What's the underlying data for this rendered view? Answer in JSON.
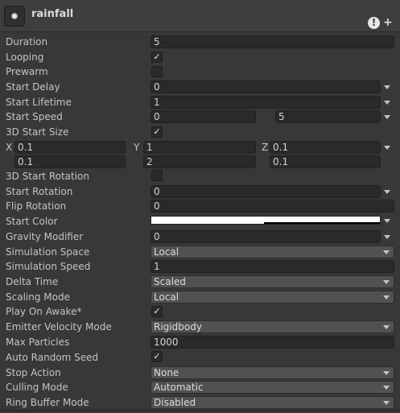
{
  "header": {
    "title": "rainfall",
    "icon": "particle-system-icon",
    "warning": "!",
    "add": "+"
  },
  "fields": {
    "duration": {
      "label": "Duration",
      "value": "5"
    },
    "looping": {
      "label": "Looping",
      "checked": true
    },
    "prewarm": {
      "label": "Prewarm",
      "checked": false
    },
    "start_delay": {
      "label": "Start Delay",
      "value": "0"
    },
    "start_lifetime": {
      "label": "Start Lifetime",
      "value": "1"
    },
    "start_speed": {
      "label": "Start Speed",
      "min": "0",
      "max": "5"
    },
    "start_size_3d": {
      "label": "3D Start Size",
      "checked": true
    },
    "start_size": {
      "x_label": "X",
      "y_label": "Y",
      "z_label": "Z",
      "x_min": "0.1",
      "y_min": "1",
      "z_min": "0.1",
      "x_max": "0.1",
      "y_max": "2",
      "z_max": "0.1"
    },
    "start_rotation_3d": {
      "label": "3D Start Rotation",
      "checked": false
    },
    "start_rotation": {
      "label": "Start Rotation",
      "value": "0"
    },
    "flip_rotation": {
      "label": "Flip Rotation",
      "value": "0"
    },
    "start_color": {
      "label": "Start Color",
      "color": "#ffffff"
    },
    "gravity_modifier": {
      "label": "Gravity Modifier",
      "value": "0"
    },
    "simulation_space": {
      "label": "Simulation Space",
      "value": "Local"
    },
    "simulation_speed": {
      "label": "Simulation Speed",
      "value": "1"
    },
    "delta_time": {
      "label": "Delta Time",
      "value": "Scaled"
    },
    "scaling_mode": {
      "label": "Scaling Mode",
      "value": "Local"
    },
    "play_on_awake": {
      "label": "Play On Awake*",
      "checked": true
    },
    "emitter_velocity_mode": {
      "label": "Emitter Velocity Mode",
      "value": "Rigidbody"
    },
    "max_particles": {
      "label": "Max Particles",
      "value": "1000"
    },
    "auto_random_seed": {
      "label": "Auto Random Seed",
      "checked": true
    },
    "stop_action": {
      "label": "Stop Action",
      "value": "None"
    },
    "culling_mode": {
      "label": "Culling Mode",
      "value": "Automatic"
    },
    "ring_buffer_mode": {
      "label": "Ring Buffer Mode",
      "value": "Disabled"
    }
  },
  "colors": {
    "panel": "#383838",
    "header": "#3e3e3e",
    "field": "#2a2a2a",
    "dropdown": "#515151",
    "text": "#c4c4c4"
  }
}
